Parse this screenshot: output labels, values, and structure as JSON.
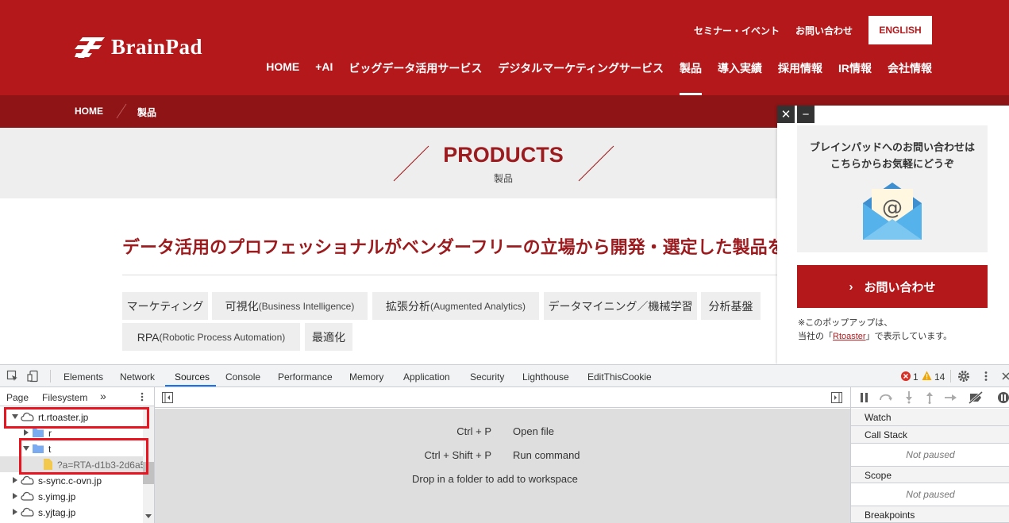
{
  "site": {
    "logo_text": "BrainPad",
    "util_links": [
      "セミナー・イベント",
      "お問い合わせ"
    ],
    "english_button": "ENGLISH",
    "nav": [
      "HOME",
      "+AI",
      "ビッグデータ活用サービス",
      "デジタルマーケティングサービス",
      "製品",
      "導入実績",
      "採用情報",
      "IR情報",
      "会社情報"
    ],
    "nav_active": "製品",
    "breadcrumb": {
      "home": "HOME",
      "current": "製品"
    },
    "hero": {
      "title": "PRODUCTS",
      "subtitle": "製品"
    },
    "lead": "データ活用のプロフェッショナルがベンダーフリーの立場から開発・選定した製品を",
    "tags": [
      {
        "main": "マーケティング",
        "sub": ""
      },
      {
        "main": "可視化",
        "sub": "(Business Intelligence)"
      },
      {
        "main": "拡張分析",
        "sub": "(Augmented Analytics)"
      },
      {
        "main": "データマイニング／機械学習",
        "sub": ""
      },
      {
        "main": "分析基盤",
        "sub": ""
      },
      {
        "main": "RPA",
        "sub": "(Robotic Process Automation)"
      },
      {
        "main": "最適化",
        "sub": ""
      }
    ]
  },
  "popup": {
    "close": "✕",
    "minimize": "−",
    "message_line1": "ブレインパッドへのお問い合わせは",
    "message_line2": "こちらからお気軽にどうぞ",
    "cta": "お問い合わせ",
    "cta_arrow": "›",
    "note_line1": "※このポップアップは、",
    "note_prefix": "当社の「",
    "note_link": "Rtoaster",
    "note_suffix": "」で表示しています。"
  },
  "devtools": {
    "tabs": [
      "Elements",
      "Network",
      "Sources",
      "Console",
      "Performance",
      "Memory",
      "Application",
      "Security",
      "Lighthouse",
      "EditThisCookie"
    ],
    "active_tab": "Sources",
    "error_count": "1",
    "warning_count": "14",
    "nav_tabs": [
      "Page",
      "Filesystem"
    ],
    "more_tabs": "»",
    "tree": [
      {
        "label": "rt.rtoaster.jp",
        "kind": "cloud",
        "level": 0,
        "open": true
      },
      {
        "label": "r",
        "kind": "folder",
        "level": 1,
        "open": false
      },
      {
        "label": "t",
        "kind": "folder",
        "level": 1,
        "open": true
      },
      {
        "label": "?a=RTA-d1b3-2d6a5",
        "kind": "file",
        "level": 2,
        "open": false
      },
      {
        "label": "s-sync.c-ovn.jp",
        "kind": "cloud",
        "level": 0,
        "open": false
      },
      {
        "label": "s.yimg.jp",
        "kind": "cloud",
        "level": 0,
        "open": false
      },
      {
        "label": "s.yjtag.jp",
        "kind": "cloud",
        "level": 0,
        "open": false
      }
    ],
    "shortcuts": [
      {
        "keys": "Ctrl + P",
        "action": "Open file"
      },
      {
        "keys": "Ctrl + Shift + P",
        "action": "Run command"
      }
    ],
    "workspace_hint": "Drop in a folder to add to workspace",
    "debug_sections": [
      "Watch",
      "Call Stack",
      "Scope",
      "Breakpoints"
    ],
    "not_paused": "Not paused",
    "colors": {
      "accent": "#1a73e8",
      "brand": "#b5181b",
      "highlight": "#e8141f"
    }
  }
}
